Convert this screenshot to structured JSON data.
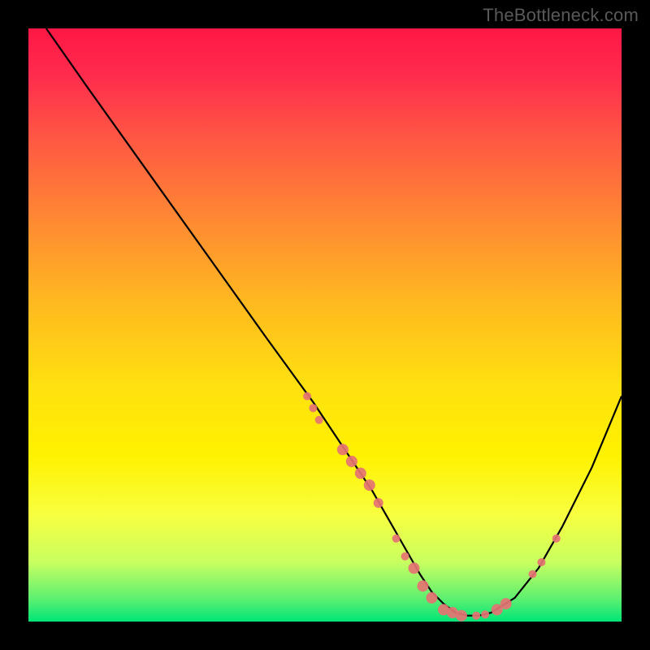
{
  "watermark": "TheBottleneck.com",
  "chart_data": {
    "type": "line",
    "title": "",
    "xlabel": "",
    "ylabel": "",
    "xlim": [
      0,
      100
    ],
    "ylim": [
      0,
      100
    ],
    "series": [
      {
        "name": "curve",
        "x": [
          3,
          10,
          20,
          30,
          40,
          48,
          54,
          58,
          62,
          66,
          68,
          70,
          72,
          74,
          76,
          78,
          82,
          86,
          90,
          95,
          100
        ],
        "y": [
          100,
          90,
          76,
          62,
          48,
          37,
          28,
          22,
          15,
          8,
          5,
          3,
          1.5,
          1,
          1,
          1.5,
          4,
          9,
          16,
          26,
          38
        ]
      }
    ],
    "markers": [
      {
        "x": 47,
        "y": 38,
        "r": 5
      },
      {
        "x": 48,
        "y": 36,
        "r": 5
      },
      {
        "x": 49,
        "y": 34,
        "r": 5
      },
      {
        "x": 53,
        "y": 29,
        "r": 7
      },
      {
        "x": 54.5,
        "y": 27,
        "r": 7
      },
      {
        "x": 56,
        "y": 25,
        "r": 7
      },
      {
        "x": 57.5,
        "y": 23,
        "r": 7
      },
      {
        "x": 59,
        "y": 20,
        "r": 6
      },
      {
        "x": 62,
        "y": 14,
        "r": 5
      },
      {
        "x": 63.5,
        "y": 11,
        "r": 5
      },
      {
        "x": 65,
        "y": 9,
        "r": 7
      },
      {
        "x": 66.5,
        "y": 6,
        "r": 7
      },
      {
        "x": 68,
        "y": 4,
        "r": 7
      },
      {
        "x": 70,
        "y": 2,
        "r": 7
      },
      {
        "x": 71.5,
        "y": 1.5,
        "r": 7
      },
      {
        "x": 73,
        "y": 1,
        "r": 7
      },
      {
        "x": 75.5,
        "y": 1,
        "r": 5
      },
      {
        "x": 77,
        "y": 1.2,
        "r": 5
      },
      {
        "x": 79,
        "y": 2,
        "r": 7
      },
      {
        "x": 80.5,
        "y": 3,
        "r": 7
      },
      {
        "x": 85,
        "y": 8,
        "r": 5
      },
      {
        "x": 86.5,
        "y": 10,
        "r": 5
      },
      {
        "x": 89,
        "y": 14,
        "r": 5
      }
    ],
    "colors": {
      "curve": "#000000",
      "marker": "#e57373",
      "background_top": "#ff1744",
      "background_bottom": "#00e676"
    }
  }
}
